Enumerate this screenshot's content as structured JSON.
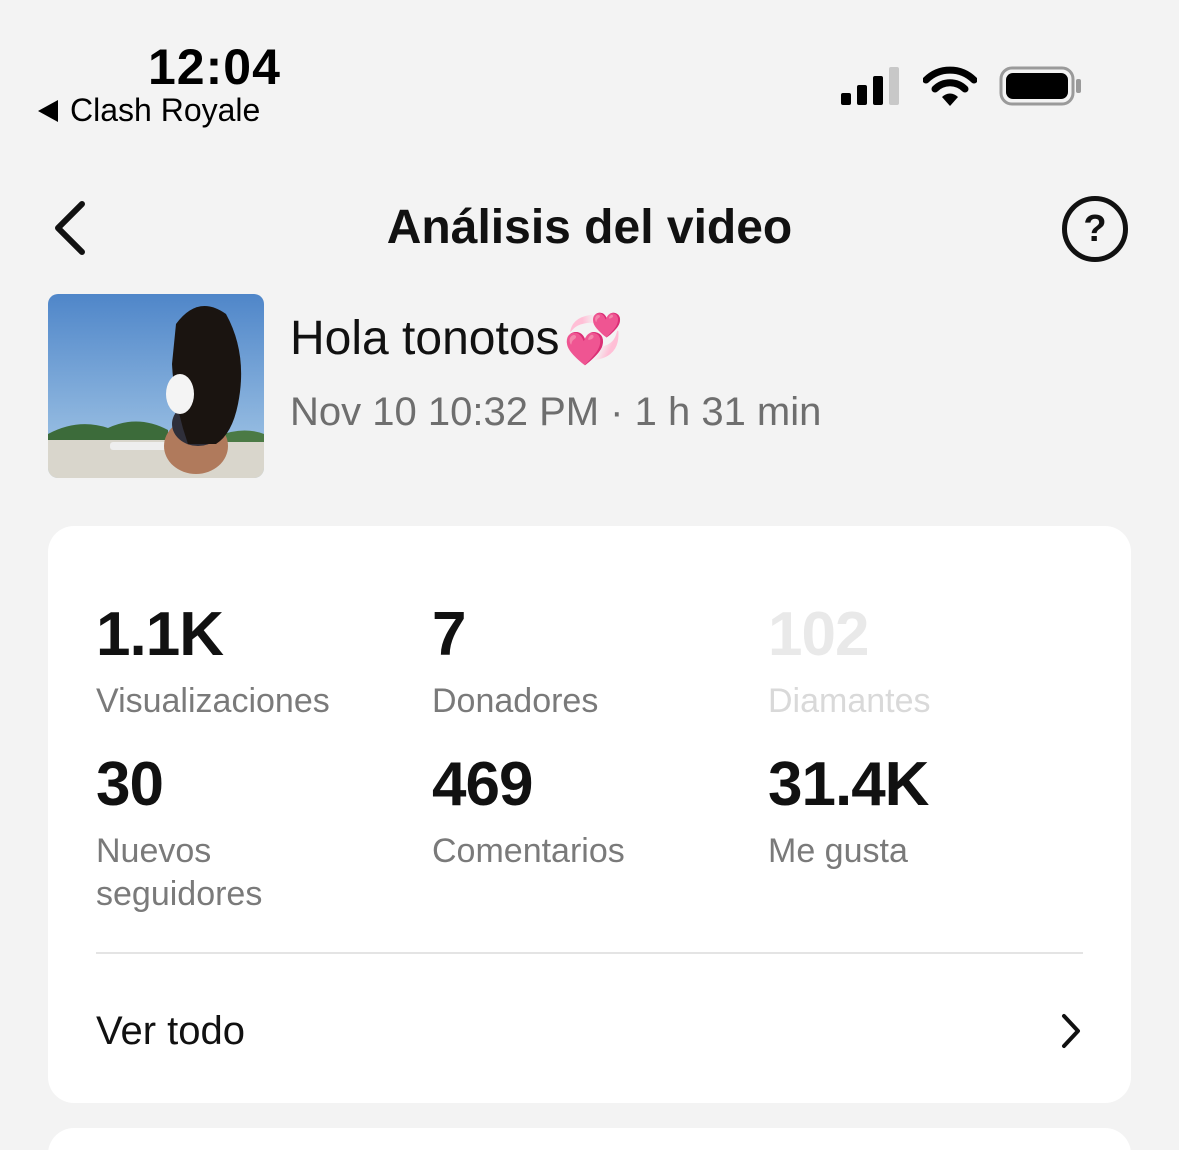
{
  "status_bar": {
    "time": "12:04",
    "back_app": "Clash Royale",
    "icons": [
      "cellular-signal-icon",
      "wifi-icon",
      "battery-icon"
    ]
  },
  "nav": {
    "title": "Análisis del video",
    "back_icon": "chevron-left-icon",
    "help_icon": "question-circle-icon",
    "help_glyph": "?"
  },
  "video": {
    "title": "Hola tonotos",
    "emoji": "💞",
    "meta": "Nov 10 10:32 PM · 1 h 31 min"
  },
  "stats": [
    {
      "value": "1.1K",
      "label": "Visualizaciones"
    },
    {
      "value": "7",
      "label": "Donadores"
    },
    {
      "value": "102",
      "label": "Diamantes"
    },
    {
      "value": "30",
      "label": "Nuevos seguidores"
    },
    {
      "value": "469",
      "label": "Comentarios"
    },
    {
      "value": "31.4K",
      "label": "Me gusta"
    }
  ],
  "see_all": {
    "label": "Ver todo",
    "icon": "chevron-right-icon"
  },
  "colors": {
    "background": "#f3f3f3",
    "card": "#ffffff",
    "text": "#111111",
    "secondary_text": "#7a7a7a"
  }
}
